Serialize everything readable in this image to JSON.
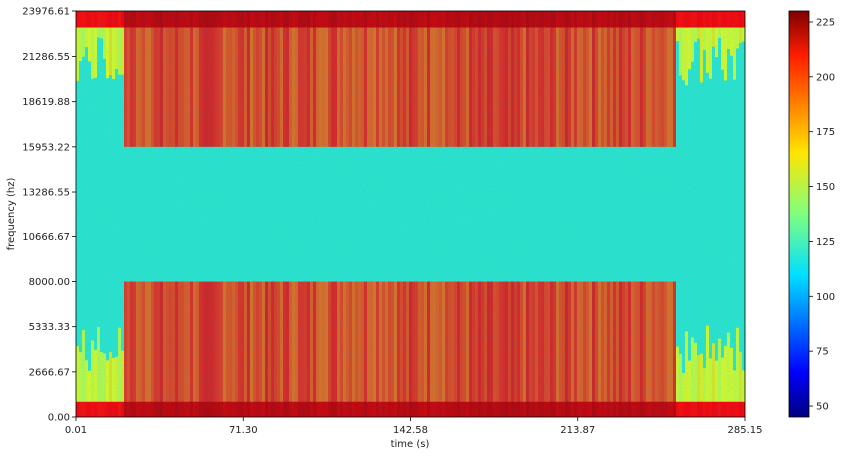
{
  "chart_data": {
    "type": "heatmap",
    "title": "",
    "xlabel": "time (s)",
    "ylabel": "frequency (hz)",
    "xlim": [
      0.01,
      285.15
    ],
    "ylim": [
      0.0,
      23976.61
    ],
    "x_ticks": [
      "0.01",
      "71.30",
      "142.58",
      "213.87",
      "285.15"
    ],
    "y_ticks": [
      "0.00",
      "2666.67",
      "5333.33",
      "8000.00",
      "10666.67",
      "13286.55",
      "15953.22",
      "18619.88",
      "21286.55",
      "23976.61"
    ],
    "colorbar": {
      "colormap": "jet",
      "range": [
        45,
        230
      ],
      "ticks": [
        "50",
        "75",
        "100",
        "125",
        "150",
        "175",
        "200",
        "225"
      ]
    },
    "grid": false,
    "legend": "none"
  }
}
